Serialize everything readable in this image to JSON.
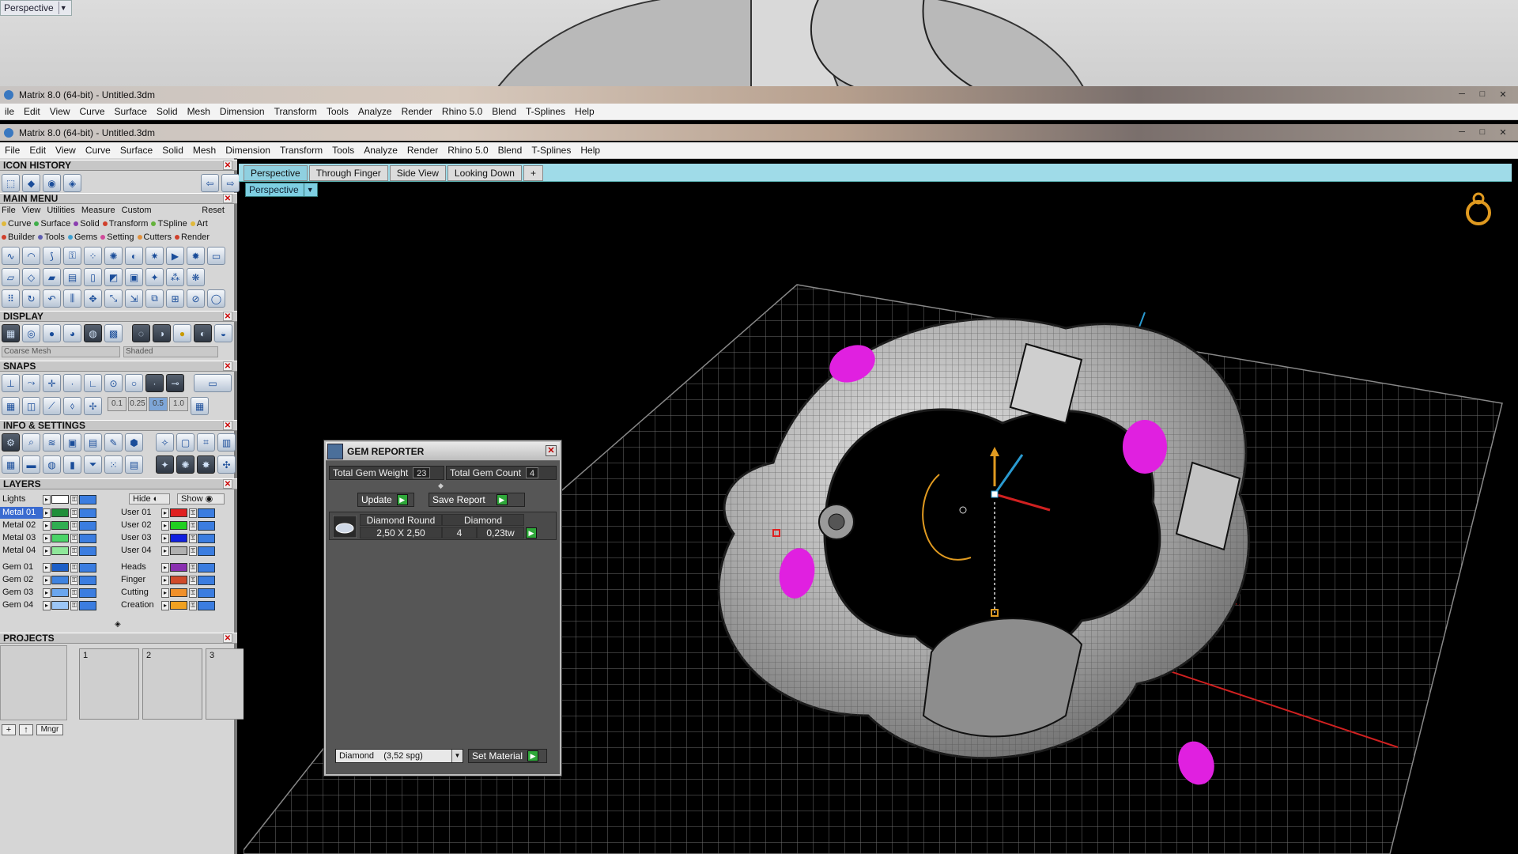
{
  "top_view": {
    "label": "Perspective"
  },
  "app": {
    "title_back": "Matrix 8.0 (64-bit) - Untitled.3dm",
    "title_front": "Matrix 8.0 (64-bit) - Untitled.3dm",
    "win_min": "─",
    "win_max": "□",
    "win_close": "✕"
  },
  "menu": [
    "File",
    "Edit",
    "View",
    "Curve",
    "Surface",
    "Solid",
    "Mesh",
    "Dimension",
    "Transform",
    "Tools",
    "Analyze",
    "Render",
    "Rhino 5.0",
    "Blend",
    "T-Splines",
    "Help"
  ],
  "menu_back": [
    "ile",
    "Edit",
    "View",
    "Curve",
    "Surface",
    "Solid",
    "Mesh",
    "Dimension",
    "Transform",
    "Tools",
    "Analyze",
    "Render",
    "Rhino 5.0",
    "Blend",
    "T-Splines",
    "Help"
  ],
  "sidebar": {
    "icon_history": "ICON HISTORY",
    "main_menu": "MAIN MENU",
    "main_menu_items": [
      "File",
      "View",
      "Utilities",
      "Measure",
      "Custom"
    ],
    "reset": "Reset",
    "cat_row1": [
      {
        "label": "Curve",
        "color": "#e0b93c"
      },
      {
        "label": "Surface",
        "color": "#3fae4a"
      },
      {
        "label": "Solid",
        "color": "#8b3fb0"
      },
      {
        "label": "Transform",
        "color": "#d0402c"
      },
      {
        "label": "TSpline",
        "color": "#64b23c"
      },
      {
        "label": "Art",
        "color": "#e0b93c"
      }
    ],
    "cat_row2": [
      {
        "label": "Builder",
        "color": "#d0402c"
      },
      {
        "label": "Tools",
        "color": "#5e5eb0"
      },
      {
        "label": "Gems",
        "color": "#3fa0d0"
      },
      {
        "label": "Setting",
        "color": "#d04a9a"
      },
      {
        "label": "Cutters",
        "color": "#e0903c"
      },
      {
        "label": "Render",
        "color": "#d0402c"
      }
    ],
    "display": "DISPLAY",
    "display_mesh": "Coarse Mesh",
    "display_mode": "Shaded",
    "snaps": "SNAPS",
    "snap_values": [
      "0.1",
      "0.25",
      "0.5",
      "1.0"
    ],
    "info_settings": "INFO & SETTINGS",
    "layers": "LAYERS",
    "lights": "Lights",
    "hide": "Hide",
    "show": "Show",
    "layers_left": [
      {
        "name": "Metal 01",
        "color": "#1f8f3a",
        "sel": true
      },
      {
        "name": "Metal 02",
        "color": "#2fae52"
      },
      {
        "name": "Metal 03",
        "color": "#4ad468"
      },
      {
        "name": "Metal 04",
        "color": "#8fe79a"
      },
      {
        "name": "Gem 01",
        "color": "#1d5fc7"
      },
      {
        "name": "Gem 02",
        "color": "#3f83e0"
      },
      {
        "name": "Gem 03",
        "color": "#6aa6ee"
      },
      {
        "name": "Gem 04",
        "color": "#9cc6f6"
      }
    ],
    "layers_right": [
      {
        "name": "User 01",
        "color": "#e02020"
      },
      {
        "name": "User 02",
        "color": "#20d020"
      },
      {
        "name": "User 03",
        "color": "#1020e0"
      },
      {
        "name": "User 04",
        "color": "#b0b0b0"
      },
      {
        "name": "Heads",
        "color": "#8a2fb0"
      },
      {
        "name": "Finger",
        "color": "#d04a2a"
      },
      {
        "name": "Cutting",
        "color": "#f0902a"
      },
      {
        "name": "Creation",
        "color": "#f0a020"
      }
    ],
    "projects": "PROJECTS",
    "project_slots": [
      "1",
      "2",
      "3"
    ],
    "mgr": "Mngr"
  },
  "viewport": {
    "tabs": [
      "Perspective",
      "Through Finger",
      "Side View",
      "Looking Down"
    ],
    "add_tab": "+",
    "label": "Perspective"
  },
  "gem_reporter": {
    "title": "GEM REPORTER",
    "weight_label": "Total Gem Weight",
    "weight_value": "23",
    "count_label": "Total Gem Count",
    "count_value": "4",
    "update": "Update",
    "save_report": "Save Report",
    "table_header": [
      "Diamond Round",
      "Diamond"
    ],
    "table_row": [
      "2,50 X 2,50",
      "4",
      "0,23tw"
    ],
    "material": "Diamond    (3,52 spg)",
    "set_material": "Set Material"
  },
  "colors": {
    "gem": "#e020e0",
    "accent": "#3b7de0",
    "axis_x": "#d02020",
    "axis_y": "#2a9ad0"
  }
}
